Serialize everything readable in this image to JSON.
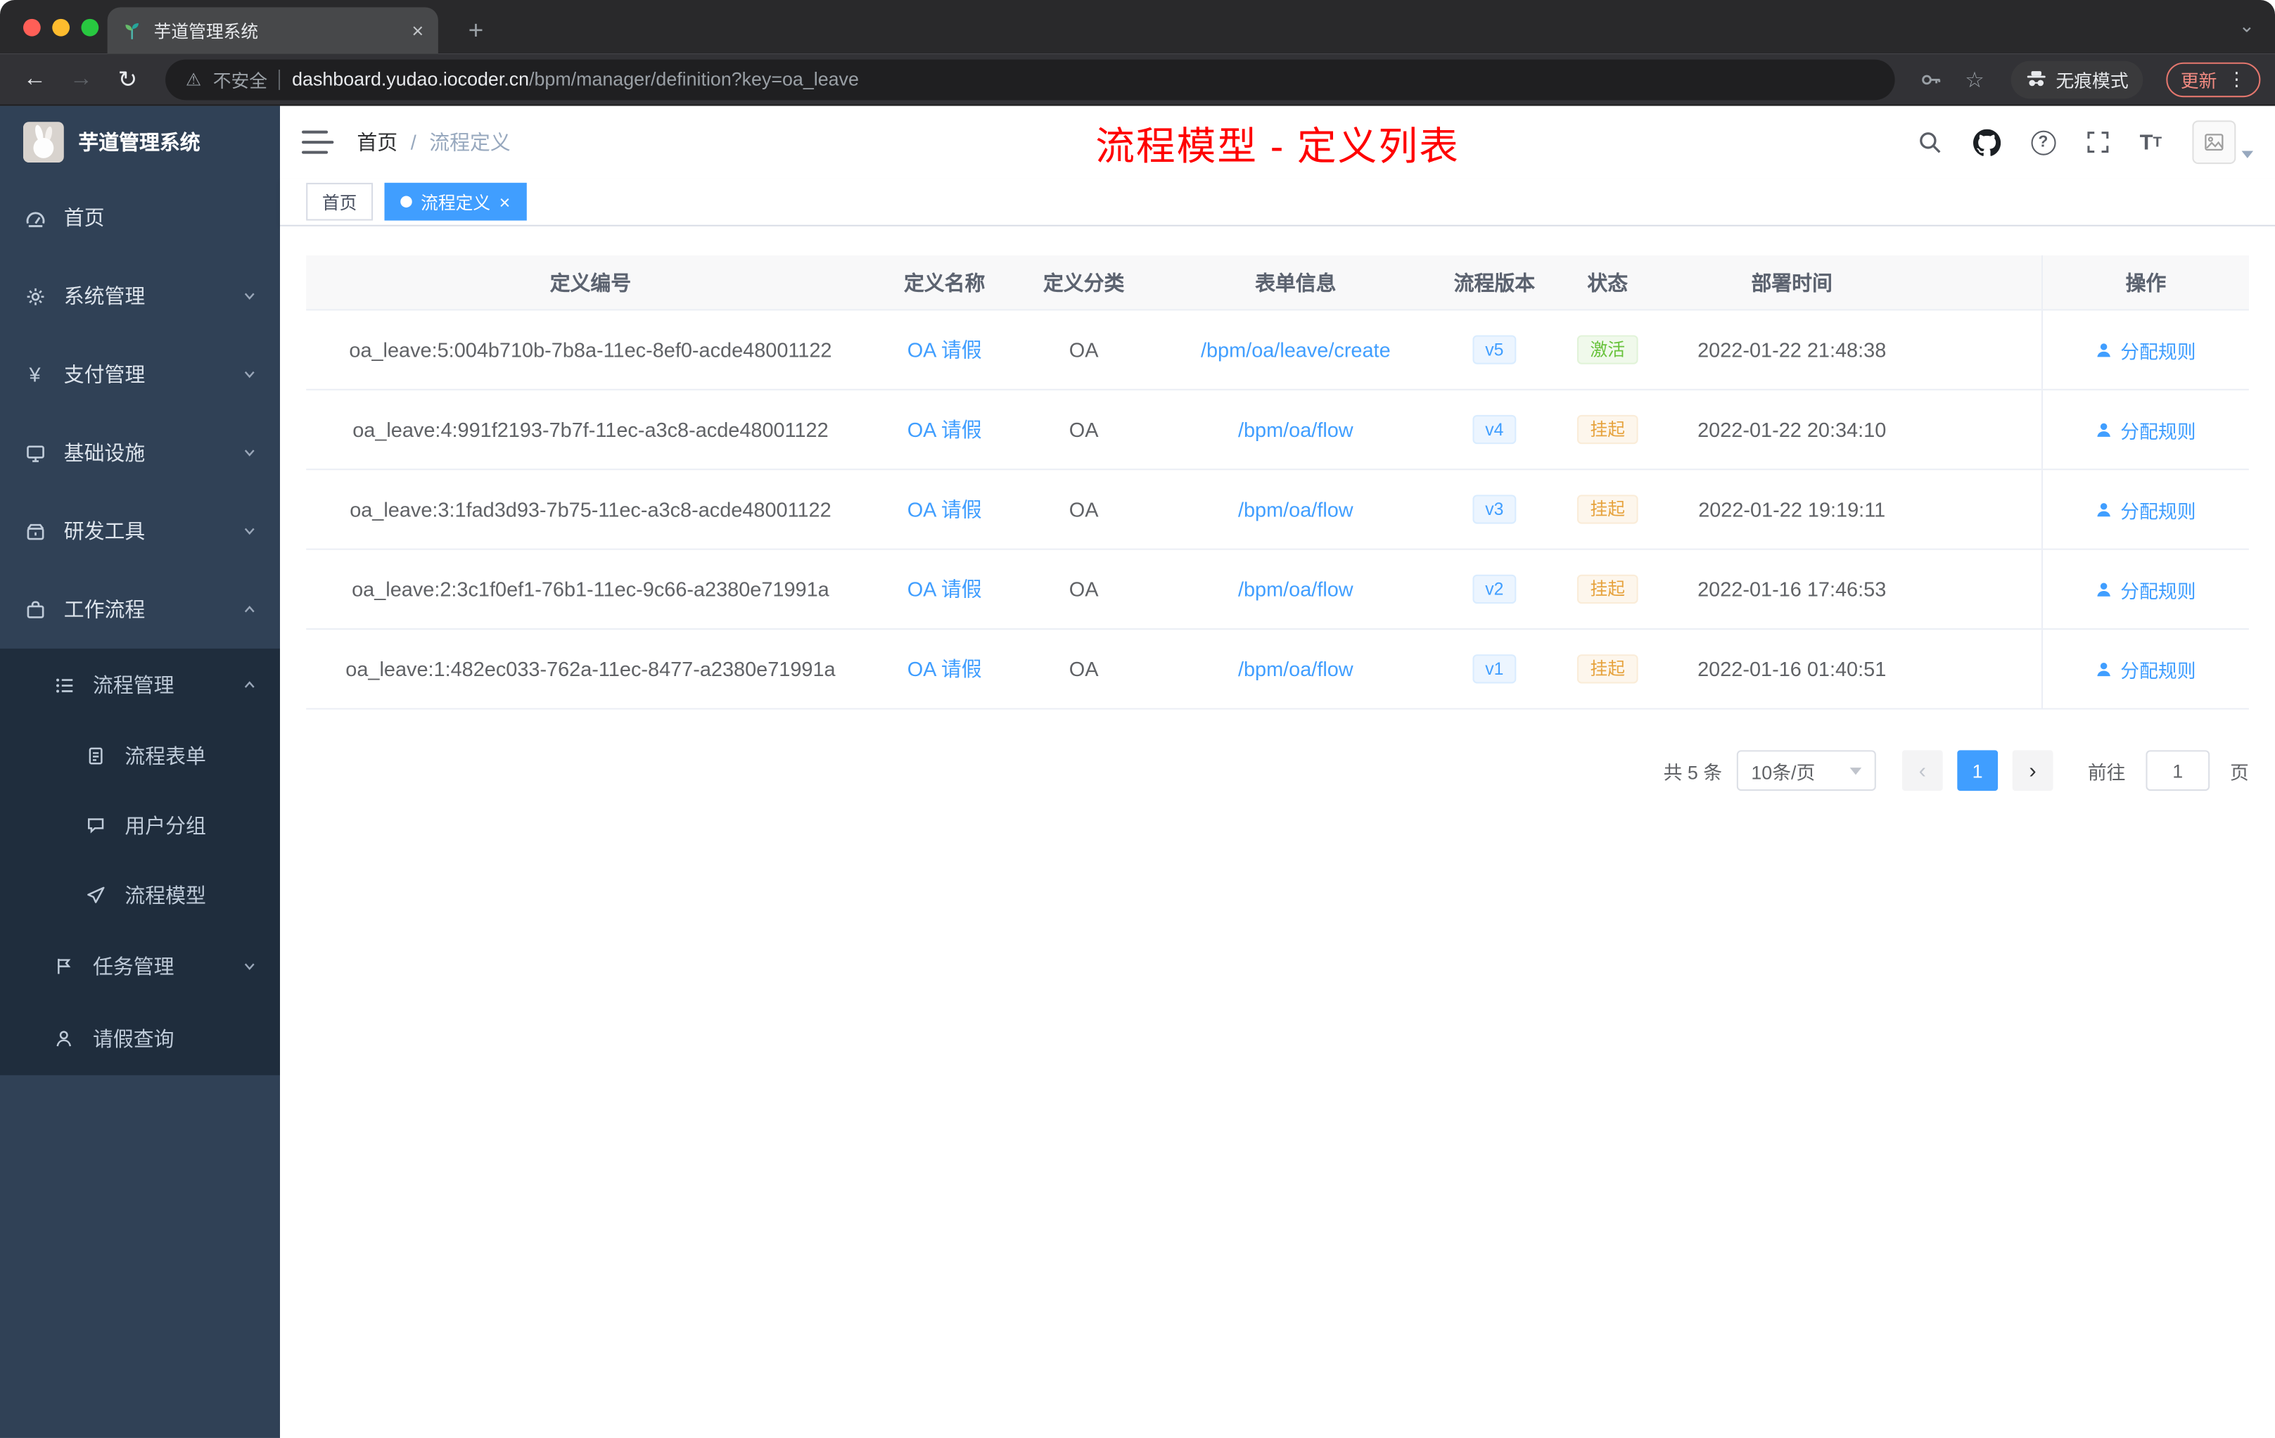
{
  "browser": {
    "tab_title": "芋道管理系统",
    "tab_close": "×",
    "new_tab": "+",
    "window_caret": "⌄",
    "back": "←",
    "forward": "→",
    "reload": "↻",
    "warning": "⚠",
    "security_label": "不安全",
    "url_host": "dashboard.yudao.iocoder.cn",
    "url_path": "/bpm/manager/definition?key=oa_leave",
    "star": "☆",
    "incognito_label": "无痕模式",
    "update_label": "更新",
    "kebab": "⋮"
  },
  "sidebar": {
    "logo_title": "芋道管理系统",
    "items": [
      {
        "label": "首页"
      },
      {
        "label": "系统管理"
      },
      {
        "label": "支付管理"
      },
      {
        "label": "基础设施"
      },
      {
        "label": "研发工具"
      },
      {
        "label": "工作流程"
      }
    ],
    "submenu": [
      {
        "label": "流程管理"
      },
      {
        "label": "流程表单"
      },
      {
        "label": "用户分组"
      },
      {
        "label": "流程模型"
      },
      {
        "label": "任务管理"
      },
      {
        "label": "请假查询"
      }
    ]
  },
  "header": {
    "breadcrumb_home": "首页",
    "breadcrumb_sep": "/",
    "breadcrumb_current": "流程定义",
    "page_title": "流程模型 - 定义列表"
  },
  "tags": {
    "home": "首页",
    "active": "流程定义",
    "close": "×"
  },
  "table": {
    "headers": [
      "定义编号",
      "定义名称",
      "定义分类",
      "表单信息",
      "流程版本",
      "状态",
      "部署时间",
      "操作"
    ],
    "action_label": "分配规则",
    "rows": [
      {
        "id": "oa_leave:5:004b710b-7b8a-11ec-8ef0-acde48001122",
        "name": "OA 请假",
        "category": "OA",
        "form": "/bpm/oa/leave/create",
        "version": "v5",
        "status": "激活",
        "status_type": "success",
        "time": "2022-01-22 21:48:38"
      },
      {
        "id": "oa_leave:4:991f2193-7b7f-11ec-a3c8-acde48001122",
        "name": "OA 请假",
        "category": "OA",
        "form": "/bpm/oa/flow",
        "version": "v4",
        "status": "挂起",
        "status_type": "warning",
        "time": "2022-01-22 20:34:10"
      },
      {
        "id": "oa_leave:3:1fad3d93-7b75-11ec-a3c8-acde48001122",
        "name": "OA 请假",
        "category": "OA",
        "form": "/bpm/oa/flow",
        "version": "v3",
        "status": "挂起",
        "status_type": "warning",
        "time": "2022-01-22 19:19:11"
      },
      {
        "id": "oa_leave:2:3c1f0ef1-76b1-11ec-9c66-a2380e71991a",
        "name": "OA 请假",
        "category": "OA",
        "form": "/bpm/oa/flow",
        "version": "v2",
        "status": "挂起",
        "status_type": "warning",
        "time": "2022-01-16 17:46:53"
      },
      {
        "id": "oa_leave:1:482ec033-762a-11ec-8477-a2380e71991a",
        "name": "OA 请假",
        "category": "OA",
        "form": "/bpm/oa/flow",
        "version": "v1",
        "status": "挂起",
        "status_type": "warning",
        "time": "2022-01-16 01:40:51"
      }
    ]
  },
  "pagination": {
    "total": "共 5 条",
    "page_size": "10条/页",
    "prev": "‹",
    "next": "›",
    "current_page": "1",
    "goto_label": "前往",
    "goto_value": "1",
    "page_unit": "页"
  },
  "icons": {
    "tab-favicon": "seedling",
    "security-warning-icon": "warning-triangle",
    "key-icon": "key",
    "star-icon": "star-outline",
    "incognito-icon": "spy-hat-glasses",
    "hamburger-icon": "menu-lines",
    "search-icon": "magnifier",
    "github-icon": "octocat",
    "help-icon": "question-circle",
    "fullscreen-icon": "expand-corners",
    "font-size-icon": "Tt",
    "avatar": "broken-image-placeholder",
    "sidebar-dashboard-icon": "gauge",
    "sidebar-gear-icon": "gear",
    "sidebar-yen-icon": "¥",
    "sidebar-infra-icon": "monitor",
    "sidebar-tools-icon": "box",
    "sidebar-workflow-icon": "briefcase",
    "sidebar-list-icon": "list",
    "sidebar-form-icon": "document",
    "sidebar-group-icon": "chat-bubble",
    "sidebar-model-icon": "paper-plane",
    "sidebar-task-icon": "flag",
    "sidebar-leave-icon": "user",
    "action-user-icon": "user"
  },
  "colors": {
    "accent": "#409eff",
    "sidebar_bg": "#304156",
    "submenu_bg": "#1f2d3d",
    "title_red": "#ff0000",
    "success": "#67c23a",
    "warning": "#e6a23c",
    "tag_home_border": "#d8dce5"
  }
}
